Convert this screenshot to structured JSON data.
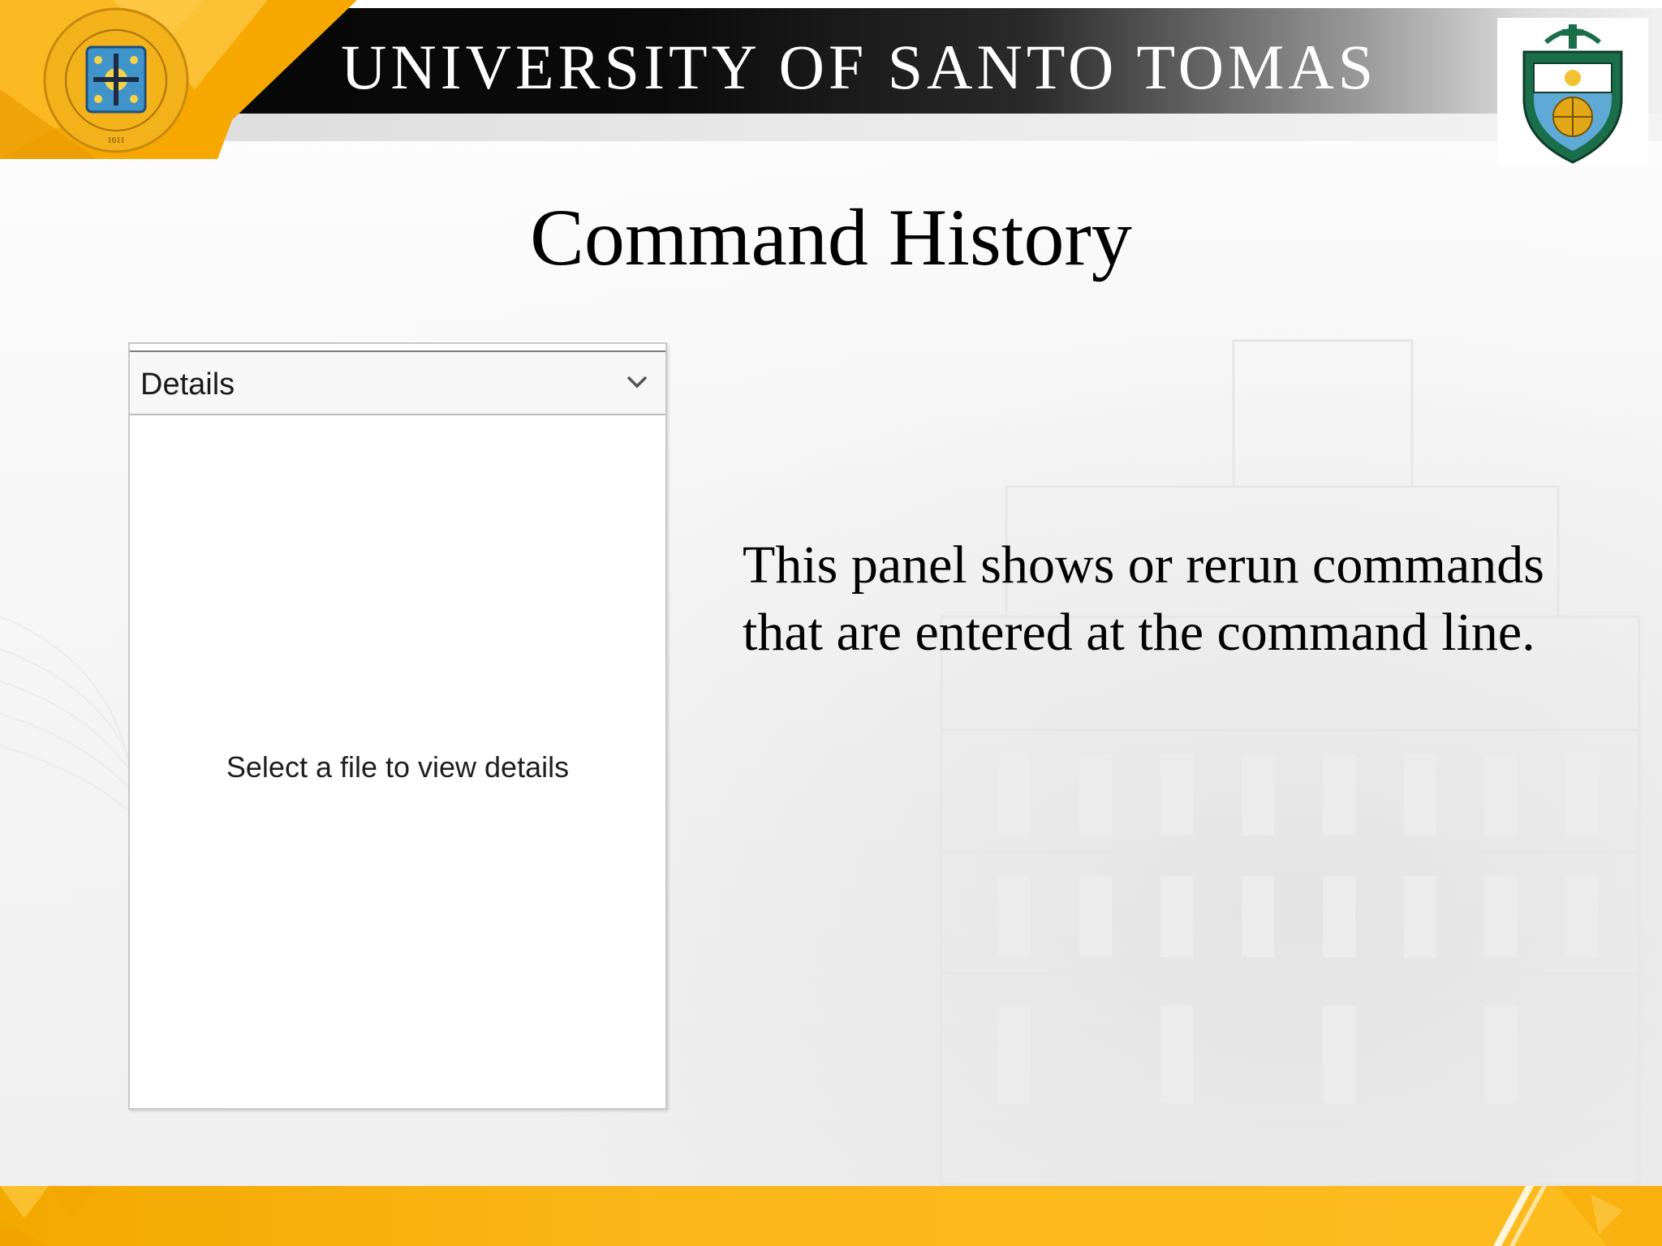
{
  "header": {
    "university_name": "UNIVERSITY OF SANTO TOMAS",
    "seal_text": "PONTIFICAL AND ROYAL UNIVERSITY OF SANTO TOMAS, MANILA",
    "seal_year": "1611"
  },
  "slide": {
    "title": "Command History",
    "description_line1": "This panel shows or rerun commands",
    "description_line2": "that are entered at the command line."
  },
  "details_panel": {
    "header_label": "Details",
    "empty_message": "Select a file to view details"
  },
  "colors": {
    "brand_gold": "#FDB913",
    "header_black": "#060606",
    "text": "#000000"
  }
}
